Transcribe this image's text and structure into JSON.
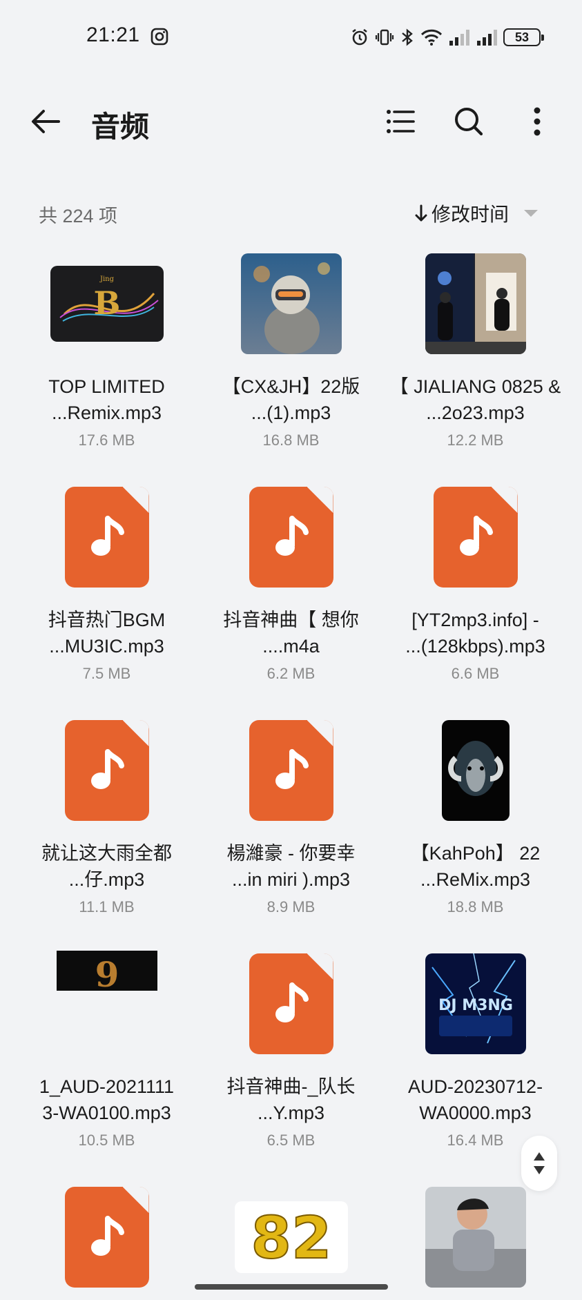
{
  "status": {
    "time": "21:21",
    "battery": "53"
  },
  "appbar": {
    "title": "音频"
  },
  "info": {
    "count": "共 224 项",
    "sort_label": "修改时间"
  },
  "files": [
    {
      "name1": "TOP LIMITED",
      "name2": "...Remix.mp3",
      "size": "17.6 MB",
      "thumb": "album-art-top-limited"
    },
    {
      "name1": "【CX&JH】22版",
      "name2": "...(1).mp3",
      "size": "16.8 MB",
      "thumb": "album-art-cat-helmet"
    },
    {
      "name1": "【 JIALIANG 0825 &",
      "name2": "...2o23.mp3",
      "size": "12.2 MB",
      "thumb": "album-art-night-photo"
    },
    {
      "name1": "抖音热门BGM",
      "name2": "...MU3IC.mp3",
      "size": "7.5 MB",
      "thumb": "audio-file-icon"
    },
    {
      "name1": "抖音神曲【 想你",
      "name2": "....m4a",
      "size": "6.2 MB",
      "thumb": "audio-file-icon"
    },
    {
      "name1": "[YT2mp3.info] -",
      "name2": "...(128kbps).mp3",
      "size": "6.6 MB",
      "thumb": "audio-file-icon"
    },
    {
      "name1": "就让这大雨全都",
      "name2": "...仔.mp3",
      "size": "11.1 MB",
      "thumb": "audio-file-icon"
    },
    {
      "name1": "楊濰豪 - 你要幸",
      "name2": "...in miri ).mp3",
      "size": "8.9 MB",
      "thumb": "audio-file-icon"
    },
    {
      "name1": "【KahPoh】 22",
      "name2": "...ReMix.mp3",
      "size": "18.8 MB",
      "thumb": "album-art-ram"
    },
    {
      "name1": "1_AUD-2021111",
      "name2": "3-WA0100.mp3",
      "size": "10.5 MB",
      "thumb": "album-art-dark-logo"
    },
    {
      "name1": "抖音神曲-_队长",
      "name2": "...Y.mp3",
      "size": "6.5 MB",
      "thumb": "audio-file-icon"
    },
    {
      "name1": "AUD-20230712-",
      "name2": "WA0000.mp3",
      "size": "16.4 MB",
      "thumb": "album-art-dj-m3ng"
    }
  ],
  "partial_row": [
    {
      "thumb": "audio-file-icon"
    },
    {
      "thumb": "album-art-82"
    },
    {
      "thumb": "album-art-boy-photo"
    }
  ]
}
